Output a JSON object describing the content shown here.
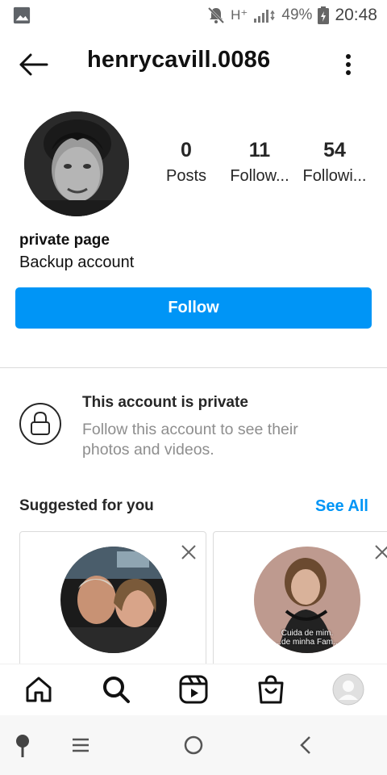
{
  "status_bar": {
    "network": "H⁺",
    "battery": "49%",
    "time": "20:48",
    "icons": [
      "image-icon",
      "bell-muted-icon",
      "signal-icon",
      "battery-icon"
    ]
  },
  "header": {
    "username": "henrycavill.0086",
    "icons": [
      "back-arrow-icon",
      "more-vertical-icon"
    ]
  },
  "profile": {
    "stats": [
      {
        "value": "0",
        "label": "Posts"
      },
      {
        "value": "11",
        "label": "Follow..."
      },
      {
        "value": "54",
        "label": "Followi..."
      }
    ],
    "name": "private page",
    "bio": "Backup account"
  },
  "follow_button": {
    "label": "Follow"
  },
  "private_notice": {
    "title": "This account is private",
    "subtitle": "Follow this account to see their photos and videos."
  },
  "suggested": {
    "title": "Suggested for you",
    "see_all": "See All",
    "card_overlay_text": [
      "Cuida de mim.",
      "...de minha Fam..."
    ]
  },
  "bottom_nav": [
    "home-icon",
    "search-icon",
    "reels-icon",
    "shop-icon",
    "profile-avatar-icon"
  ],
  "android_nav": [
    "assistant-icon",
    "menu-icon",
    "home-circle-icon",
    "back-chevron-icon"
  ],
  "colors": {
    "accent": "#0095f6",
    "text": "#262626",
    "muted": "#8e8e8e",
    "divider": "#dbdbdb"
  }
}
